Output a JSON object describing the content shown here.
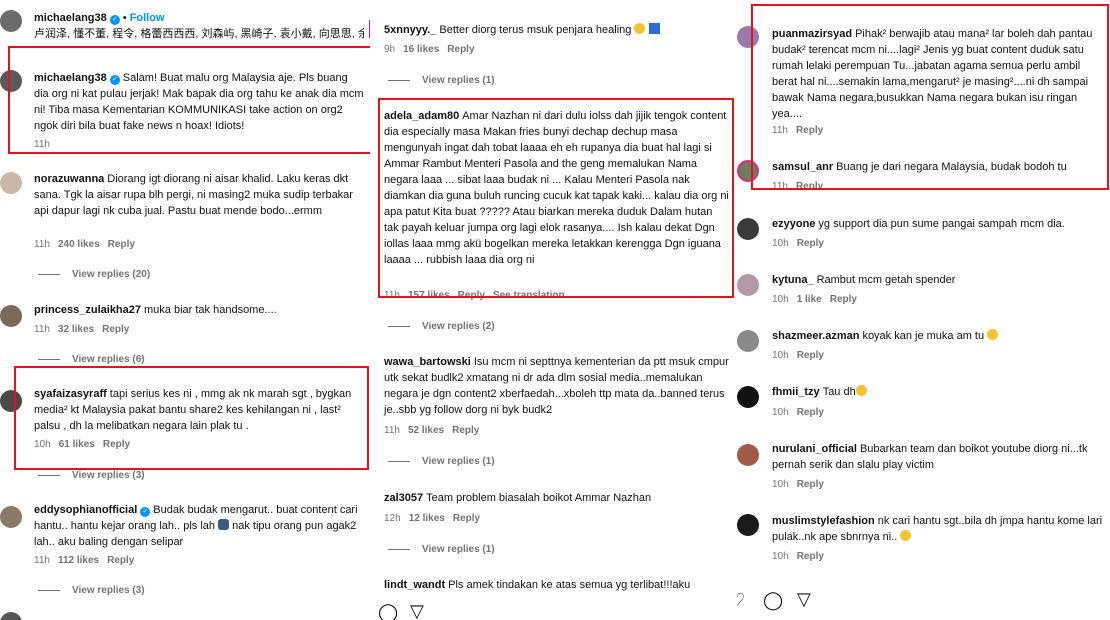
{
  "col1": {
    "top_comment": {
      "username": "michaelang38",
      "follow": "Follow",
      "text": "卢润泽, 懂不董, 程令, 格蕾西西西, 刘森屿, 黑崎子, 袁小戴, 向思思, 余火..."
    },
    "comments": [
      {
        "username": "michaelang38",
        "verified": true,
        "text": "Salam! Buat malu org Malaysia aje. Pls buang dia org ni kat pulau jerjak! Mak bapak dia org tahu ke anak dia mcm ni! Tiba masa Kementarian KOMMUNIKASI take action on org2 ngok diri bila buat fake news n hoax! Idiots!",
        "time": "11h"
      },
      {
        "username": "norazuwanna",
        "text": "Diorang igt diorang ni aisar khalid. Laku keras dkt sana. Tgk la aisar rupa blh pergi, ni masing2 muka sudip terbakar api dapur lagi nk cuba jual. Pastu buat mende bodo...ermm",
        "time": "11h",
        "likes": "240 likes",
        "reply": "Reply",
        "view_replies": "View replies (20)"
      },
      {
        "username": "princess_zulaikha27",
        "text": "muka biar tak handsome....",
        "time": "11h",
        "likes": "32 likes",
        "reply": "Reply",
        "view_replies": "View replies (6)"
      },
      {
        "username": "syafaizasyraff",
        "text": "tapi serius kes ni , mmg ak nk marah sgt , bygkan media² kt Malaysia pakat bantu share2 kes kehilangan ni , last² palsu , dh la melibatkan negara lain plak tu .",
        "time": "10h",
        "likes": "61 likes",
        "reply": "Reply",
        "view_replies": "View replies (3)"
      },
      {
        "username": "eddysophianofficial",
        "verified": true,
        "text": "Budak budak mengarut.. buat content cari hantu.. hantu kejar orang lah.. pls lah",
        "text2": "nak tipu orang pun agak2 lah.. aku baling dengan selipar",
        "time": "11h",
        "likes": "112 likes",
        "reply": "Reply",
        "view_replies": "View replies (3)"
      }
    ]
  },
  "col2": {
    "comments": [
      {
        "username": "5xnnyyy._",
        "text": "Better diorg terus msuk penjara healing",
        "time": "9h",
        "likes": "16 likes",
        "reply": "Reply",
        "view_replies": "View replies (1)"
      },
      {
        "username": "adela_adam80",
        "text": "Amar Nazhan ni dari dulu iolss dah jijik tengok content dia especially masa Makan fries bunyi dechap dechup masa mengunyah ingat dah tobat laaaa eh eh rupanya dia buat hal lagi si Ammar Rambut Menteri Pasola and the geng memalukan Nama negara laaa ... sibat laaa budak ni ... Kalau Menteri Pasola nak diamkan dia guna buluh runcing cucuk kat tapak kaki... kalau dia org ni apa patut Kita buat ????? Atau biarkan mereka duduk Dalam hutan tak payah keluar jumpa org lagi elok rasanya.... Ish kalau dekat Dgn iollas laaa mmg akü bogelkan mereka letakkan kerengga Dgn iguana laaaa ... rubbish laaa dia org ni",
        "time": "11h",
        "likes": "157 likes",
        "reply": "Reply",
        "see_translation": "See translation",
        "view_replies": "View replies (2)"
      },
      {
        "username": "wawa_bartowski",
        "text": "Isu mcm ni septtnya kementerian da ptt msuk cmpur utk sekat budlk2 xmatang ni dr ada dlm sosial media..memalukan negara je dgn content2 xberfaedah...xboleh ttp mata da..banned terus je..sbb yg follow dorg ni byk budk2",
        "time": "11h",
        "likes": "52 likes",
        "reply": "Reply",
        "view_replies": "View replies (1)"
      },
      {
        "username": "zal3057",
        "text": "Team problem biasalah boikot Ammar Nazhan",
        "time": "12h",
        "likes": "12 likes",
        "reply": "Reply",
        "view_replies": "View replies (1)"
      },
      {
        "username": "lindt_wandt",
        "text": "Pls amek tindakan ke atas semua yg terlibat!!!aku"
      }
    ]
  },
  "col3": {
    "comments": [
      {
        "username": "puanmazirsyad",
        "text": "Pihak² berwajib atau mana² lar boleh dah pantau budak² terencat mcm ni....lagi² Jenis yg buat content duduk satu rumah lelaki perempuan Tu...jabatan agama semua perlu ambil berat hal ni....semakin lama,mengarut² je masing²....ni dh sampai bawak Nama negara,busukkan Nama negara bukan isu ringan yea....",
        "time": "11h",
        "reply": "Reply"
      },
      {
        "username": "samsul_anr",
        "text": "Buang je dari negara Malaysia, budak bodoh tu",
        "time": "11h",
        "reply": "Reply"
      },
      {
        "username": "ezyyone",
        "text": "yg support dia pun sume pangai sampah mcm dia.",
        "time": "10h",
        "reply": "Reply"
      },
      {
        "username": "kytuna_",
        "text": "Rambut mcm getah spender",
        "time": "10h",
        "likes": "1 like",
        "reply": "Reply"
      },
      {
        "username": "shazmeer.azman",
        "text": "koyak kan je muka am tu",
        "time": "10h",
        "reply": "Reply"
      },
      {
        "username": "fhmii_tzy",
        "text": "Tau dh",
        "time": "10h",
        "reply": "Reply"
      },
      {
        "username": "nurulani_official",
        "text": "Bubarkan team dan boikot youtube diorg ni...tk pernah serik dan slalu play victim",
        "time": "10h",
        "reply": "Reply"
      },
      {
        "username": "muslimstylefashion",
        "text": "nk cari hantu sgt..bila dh jmpa hantu kome lari pulak..nk ape sbnrnya ni..",
        "time": "10h",
        "reply": "Reply"
      }
    ]
  },
  "icons": {
    "like": "heart-icon",
    "comment": "comment-icon",
    "share": "send-icon"
  },
  "colors": {
    "highlight": "#e0141e",
    "verified": "#0095f6",
    "muted": "#737373"
  }
}
